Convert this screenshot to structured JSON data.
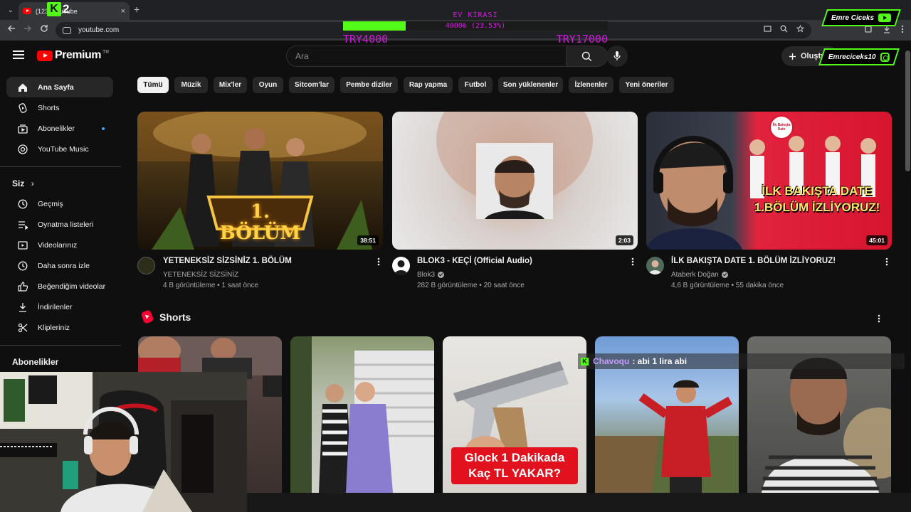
{
  "browser": {
    "tab_title": "(123) YouTube",
    "url": "youtube.com",
    "new_tab": "+",
    "close": "×",
    "tab_list": "⌄"
  },
  "stream": {
    "kick_letter": "K",
    "kick_number": "2",
    "rent_title": "EV KİRASI",
    "rent_amount": "4000₺ (23.53%)",
    "rent_progress": 23.53,
    "rent_min": "TRY4000",
    "rent_max": "TRY17000",
    "youtube_handle": "Emre Ciceks",
    "instagram_handle": "Emreciceks10",
    "chat_badge": "K",
    "chat_user": "Chavoqu",
    "chat_message": ": abi 1 lira abi"
  },
  "youtube": {
    "logo_text": "Premium",
    "country": "TR",
    "search_placeholder": "Ara",
    "create_label": "Oluştur"
  },
  "sidebar": {
    "main": [
      {
        "label": "Ana Sayfa",
        "icon": "home-icon",
        "active": true
      },
      {
        "label": "Shorts",
        "icon": "shorts-icon"
      },
      {
        "label": "Abonelikler",
        "icon": "subscriptions-icon",
        "dot": true
      },
      {
        "label": "YouTube Music",
        "icon": "music-icon"
      }
    ],
    "you_heading": "Siz",
    "you": [
      {
        "label": "Geçmiş",
        "icon": "history-icon"
      },
      {
        "label": "Oynatma listeleri",
        "icon": "playlists-icon"
      },
      {
        "label": "Videolarınız",
        "icon": "your-videos-icon"
      },
      {
        "label": "Daha sonra izle",
        "icon": "watch-later-icon"
      },
      {
        "label": "Beğendiğim videolar",
        "icon": "liked-icon"
      },
      {
        "label": "İndirilenler",
        "icon": "downloads-icon"
      },
      {
        "label": "Klipleriniz",
        "icon": "clips-icon"
      }
    ],
    "subscriptions_heading": "Abonelikler"
  },
  "chips": [
    "Tümü",
    "Müzik",
    "Mix'ler",
    "Oyun",
    "Sitcom'lar",
    "Pembe diziler",
    "Rap yapma",
    "Futbol",
    "Son yüklenenler",
    "İzlenenler",
    "Yeni öneriler"
  ],
  "videos": [
    {
      "title": "YETENEKSİZ SİZSİNİZ 1. BÖLÜM",
      "channel": "YETENEKSİZ SİZSİNİZ",
      "views": "4 B görüntüleme",
      "age": "1 saat önce",
      "duration": "38:51",
      "verified": false,
      "thumb_text": "1. BÖLÜM"
    },
    {
      "title": "BLOK3 - KEÇİ (Official Audio)",
      "channel": "Blok3",
      "views": "282 B görüntüleme",
      "age": "20 saat önce",
      "duration": "2:03",
      "verified": true
    },
    {
      "title": "İLK BAKIŞTA DATE 1. BÖLÜM İZLİYORUZ!",
      "channel": "Ataberk Doğan",
      "views": "4,6 B görüntüleme",
      "age": "55 dakika önce",
      "duration": "45:01",
      "verified": true,
      "thumb_text": "İLK BAKIŞTA DATE 1.BÖLÜM İZLİYORUZ!",
      "badge_text": "İlk Bakışta Date"
    }
  ],
  "view_separator": "•",
  "shorts": {
    "title": "Shorts",
    "caption": "Glock 1 Dakikada Kaç TL YAKAR?"
  }
}
